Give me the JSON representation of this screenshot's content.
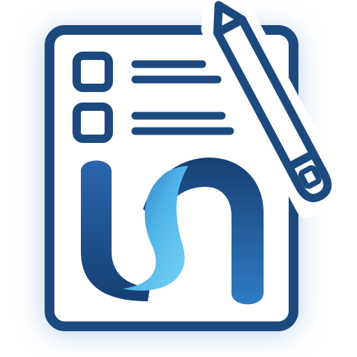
{
  "icon": {
    "name": "checklist-document-with-pencil-and-logo",
    "colors": {
      "outline": "#1c4a7e",
      "paper": "#ffffff",
      "glow": "#8fb6dd",
      "logo_dark": "#1b4f8c",
      "logo_mid": "#2f6fb3",
      "logo_light": "#5cc3ee"
    },
    "checklist": {
      "items": [
        {
          "checked": false
        },
        {
          "checked": false
        }
      ]
    }
  }
}
